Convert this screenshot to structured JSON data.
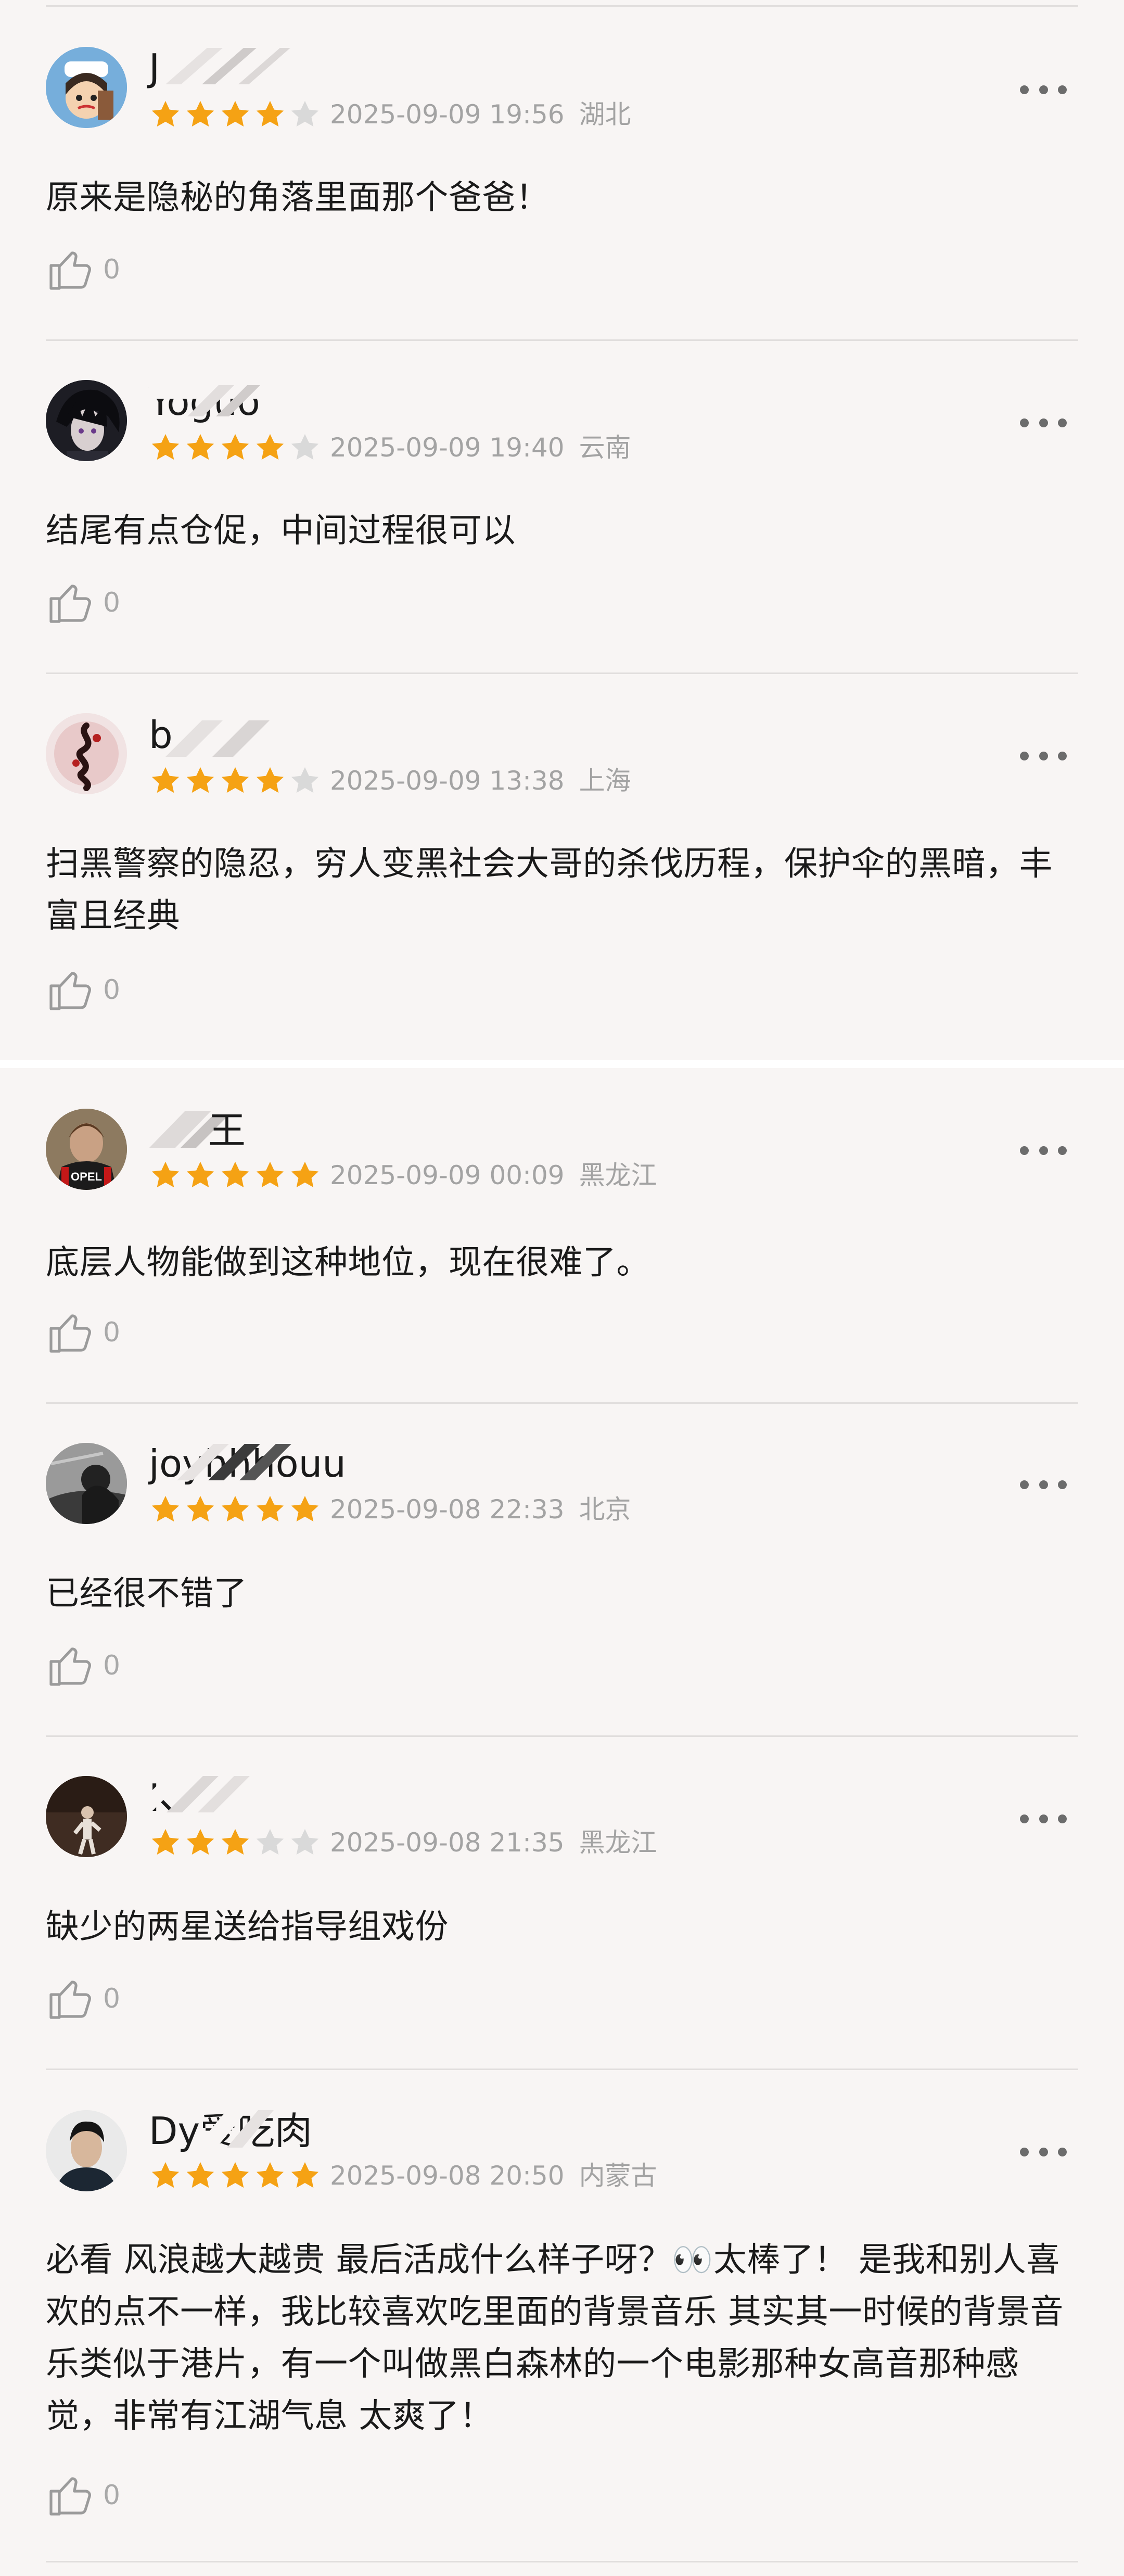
{
  "colors": {
    "star_filled": "#f5a214",
    "star_empty": "#d9d9d9",
    "meta_text": "#a3a3a3",
    "background": "#f8f5f4"
  },
  "icons": {
    "like": "thumbs-up-icon",
    "more": "more-dots-icon",
    "star": "star-icon"
  },
  "reviews": [
    {
      "username": "J",
      "rating": 4,
      "date": "2025-09-09 19:56",
      "location": "湖北",
      "content": "原来是隐秘的角落里面那个爸爸！",
      "likes": "0"
    },
    {
      "username": "Yoguo",
      "rating": 4,
      "date": "2025-09-09 19:40",
      "location": "云南",
      "content": "结尾有点仓促，中间过程很可以",
      "likes": "0"
    },
    {
      "username": "b",
      "rating": 4,
      "date": "2025-09-09 13:38",
      "location": "上海",
      "content": "扫黑警察的隐忍，穷人变黑社会大哥的杀伐历程，保护伞的黑暗，丰富且经典",
      "likes": "0"
    },
    {
      "username": "王",
      "rating": 5,
      "date": "2025-09-09 00:09",
      "location": "黑龙江",
      "content": "底层人物能做到这种地位，现在很难了。",
      "likes": "0"
    },
    {
      "username": "joyhhhouu",
      "rating": 5,
      "date": "2025-09-08 22:33",
      "location": "北京",
      "content": "已经很不错了",
      "likes": "0"
    },
    {
      "username": "K",
      "rating": 3,
      "date": "2025-09-08 21:35",
      "location": "黑龙江",
      "content": "缺少的两星送给指导组戏份",
      "likes": "0"
    },
    {
      "username": "Dy爱吃肉",
      "rating": 5,
      "date": "2025-09-08 20:50",
      "location": "内蒙古",
      "content": "必看 风浪越大越贵  最后活成什么样子呀？👀太棒了！ 是我和别人喜欢的点不一样，我比较喜欢吃里面的背景音乐  其实其一时候的背景音乐类似于港片，有一个叫做黑白森林的一个电影那种女高音那种感觉，非常有江湖气息 太爽了！",
      "likes": "0"
    }
  ]
}
